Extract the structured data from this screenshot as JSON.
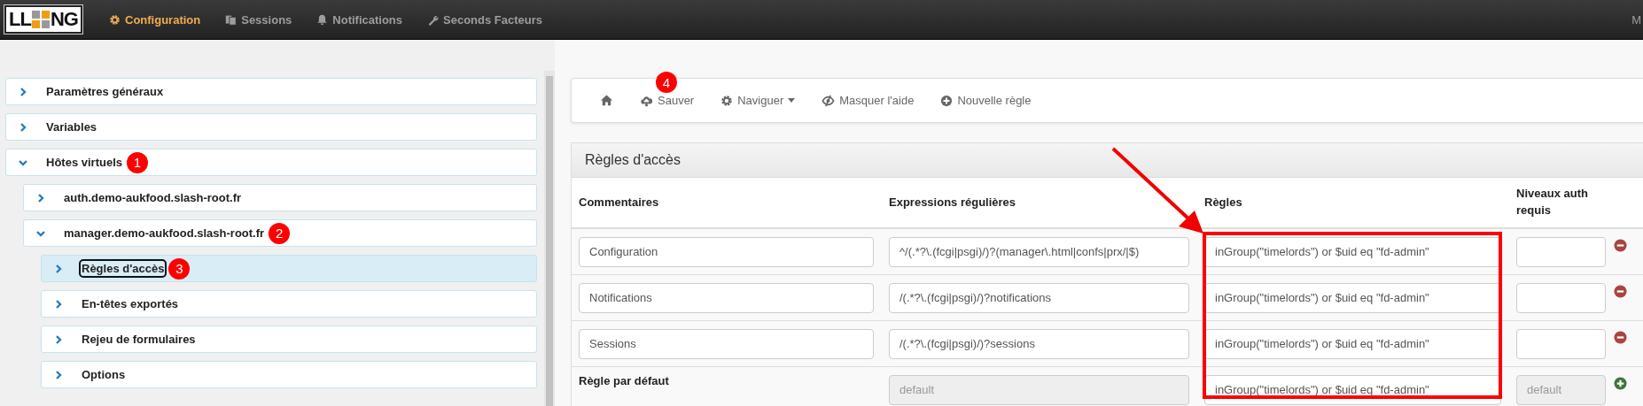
{
  "topbar": {
    "logo": {
      "left": "LL",
      "right": "NG"
    },
    "nav": [
      {
        "label": "Configuration",
        "selected": true
      },
      {
        "label": "Sessions",
        "selected": false
      },
      {
        "label": "Notifications",
        "selected": false
      },
      {
        "label": "Seconds Facteurs",
        "selected": false
      }
    ],
    "user": "M"
  },
  "tree": [
    {
      "label": "Paramètres généraux",
      "expanded": false,
      "selected": false
    },
    {
      "label": "Variables",
      "expanded": false,
      "selected": false
    },
    {
      "label": "Hôtes virtuels",
      "expanded": true,
      "selected": false,
      "marker": "1",
      "children": [
        {
          "label": "auth.demo-aukfood.slash-root.fr",
          "expanded": false,
          "selected": false
        },
        {
          "label": "manager.demo-aukfood.slash-root.fr",
          "expanded": true,
          "selected": false,
          "marker": "2",
          "children": [
            {
              "label": "Règles d'accès",
              "expanded": false,
              "selected": true,
              "marker": "3"
            },
            {
              "label": "En-têtes exportés",
              "expanded": false,
              "selected": false
            },
            {
              "label": "Rejeu de formulaires",
              "expanded": false,
              "selected": false
            },
            {
              "label": "Options",
              "expanded": false,
              "selected": false
            }
          ]
        }
      ]
    }
  ],
  "toolbar": [
    {
      "label": "Sauver",
      "dropdown": false,
      "marker": "4"
    },
    {
      "label": "Naviguer",
      "dropdown": true
    },
    {
      "label": "Masquer l'aide",
      "dropdown": false
    },
    {
      "label": "Nouvelle règle",
      "dropdown": false
    }
  ],
  "panel": {
    "title": "Règles d'accès",
    "columns": [
      "Commentaires",
      "Expressions régulières",
      "Règles",
      "Niveaux auth requis"
    ],
    "rows": [
      {
        "kind": "rule",
        "comment": "Configuration",
        "regex": "^/(.*?\\.(fcgi|psgi)/)?(manager\\.html|confs|prx/|$)",
        "rule": "inGroup(\"timelords\") or $uid eq \"fd-admin\""
      },
      {
        "kind": "rule",
        "comment": "Notifications",
        "regex": "/(.*?\\.(fcgi|psgi)/)?notifications",
        "rule": "inGroup(\"timelords\") or $uid eq \"fd-admin\""
      },
      {
        "kind": "rule",
        "comment": "Sessions",
        "regex": "/(.*?\\.(fcgi|psgi)/)?sessions",
        "rule": "inGroup(\"timelords\") or $uid eq \"fd-admin\""
      },
      {
        "kind": "default",
        "comment": "Règle par défaut",
        "regex": "default",
        "rule": "inGroup(\"timelords\") or $uid eq \"fd-admin\"",
        "level": "default"
      }
    ]
  }
}
